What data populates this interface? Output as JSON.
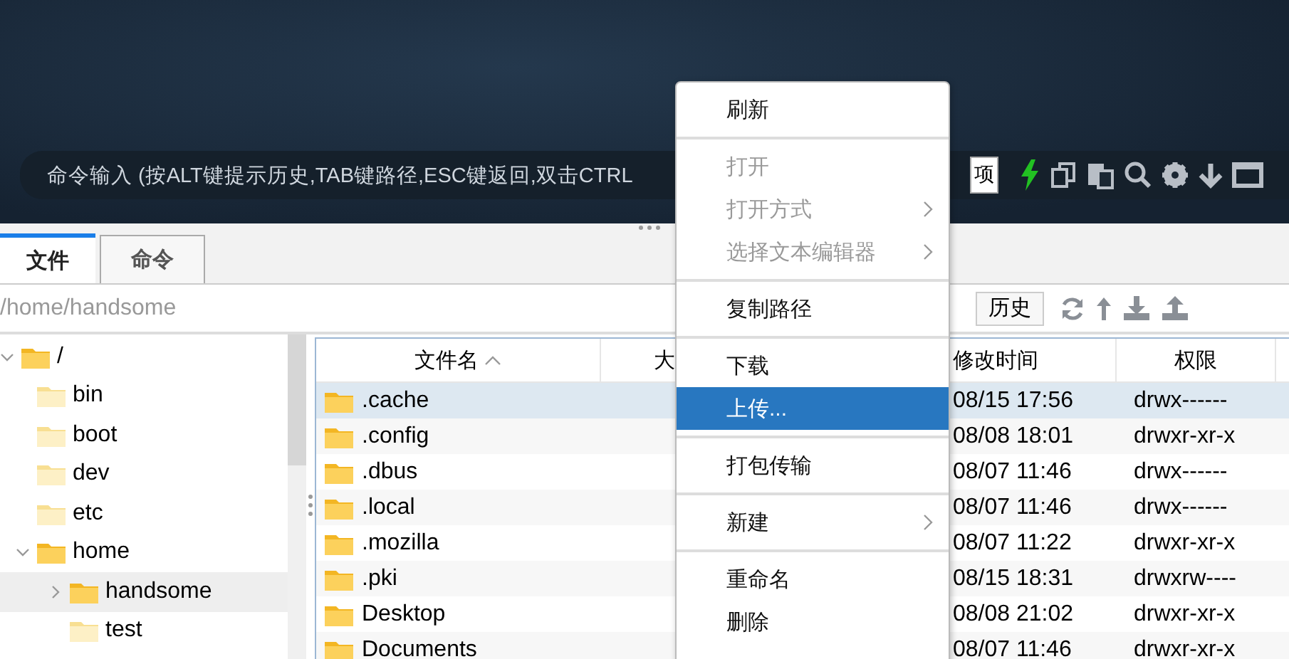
{
  "command_bar": {
    "placeholder": "命令输入 (按ALT键提示历史,TAB键路径,ESC键返回,双击CTRL",
    "option_button": "项"
  },
  "tabs": [
    {
      "label": "文件",
      "selected": true
    },
    {
      "label": "命令",
      "selected": false
    }
  ],
  "path_bar": {
    "path": "/home/handsome",
    "history_button": "历史"
  },
  "tree": [
    {
      "name": "/",
      "expanded": true,
      "selected": false,
      "children": [
        {
          "name": "bin",
          "expanded": false,
          "selected": false
        },
        {
          "name": "boot",
          "expanded": false,
          "selected": false
        },
        {
          "name": "dev",
          "expanded": false,
          "selected": false
        },
        {
          "name": "etc",
          "expanded": false,
          "selected": false
        },
        {
          "name": "home",
          "expanded": true,
          "selected": false,
          "children": [
            {
              "name": "handsome",
              "expanded": false,
              "selected": true
            },
            {
              "name": "test",
              "expanded": false,
              "selected": false
            }
          ]
        }
      ]
    }
  ],
  "table": {
    "columns": [
      {
        "label": "文件名",
        "sorted": true
      },
      {
        "label": "大",
        "sorted": false
      },
      {
        "label": "修改时间",
        "sorted": false
      },
      {
        "label": "权限",
        "sorted": false
      }
    ],
    "rows": [
      {
        "name": ".cache",
        "modified": "08/15 17:56",
        "permissions": "drwx------",
        "selected": true
      },
      {
        "name": ".config",
        "modified": "08/08 18:01",
        "permissions": "drwxr-xr-x",
        "selected": false
      },
      {
        "name": ".dbus",
        "modified": "08/07 11:46",
        "permissions": "drwx------",
        "selected": false
      },
      {
        "name": ".local",
        "modified": "08/07 11:46",
        "permissions": "drwx------",
        "selected": false
      },
      {
        "name": ".mozilla",
        "modified": "08/07 11:22",
        "permissions": "drwxr-xr-x",
        "selected": false
      },
      {
        "name": ".pki",
        "modified": "08/15 18:31",
        "permissions": "drwxrw----",
        "selected": false
      },
      {
        "name": "Desktop",
        "modified": "08/08 21:02",
        "permissions": "drwxr-xr-x",
        "selected": false
      },
      {
        "name": "Documents",
        "modified": "08/07 11:46",
        "permissions": "drwxr-xr-x",
        "selected": false
      }
    ]
  },
  "context_menu": [
    {
      "kind": "item",
      "label": "刷新",
      "disabled": false,
      "selected": false,
      "submenu": false
    },
    {
      "kind": "separator"
    },
    {
      "kind": "item",
      "label": "打开",
      "disabled": true,
      "selected": false,
      "submenu": false
    },
    {
      "kind": "item",
      "label": "打开方式",
      "disabled": true,
      "selected": false,
      "submenu": true
    },
    {
      "kind": "item",
      "label": "选择文本编辑器",
      "disabled": true,
      "selected": false,
      "submenu": true
    },
    {
      "kind": "separator"
    },
    {
      "kind": "item",
      "label": "复制路径",
      "disabled": false,
      "selected": false,
      "submenu": false
    },
    {
      "kind": "separator"
    },
    {
      "kind": "item",
      "label": "下载",
      "disabled": false,
      "selected": false,
      "submenu": false
    },
    {
      "kind": "item",
      "label": "上传...",
      "disabled": false,
      "selected": true,
      "submenu": false
    },
    {
      "kind": "separator"
    },
    {
      "kind": "item",
      "label": "打包传输",
      "disabled": false,
      "selected": false,
      "submenu": false
    },
    {
      "kind": "separator"
    },
    {
      "kind": "item",
      "label": "新建",
      "disabled": false,
      "selected": false,
      "submenu": true
    },
    {
      "kind": "separator"
    },
    {
      "kind": "item",
      "label": "重命名",
      "disabled": false,
      "selected": false,
      "submenu": false
    },
    {
      "kind": "item",
      "label": "删除",
      "disabled": false,
      "selected": false,
      "submenu": false
    }
  ]
}
